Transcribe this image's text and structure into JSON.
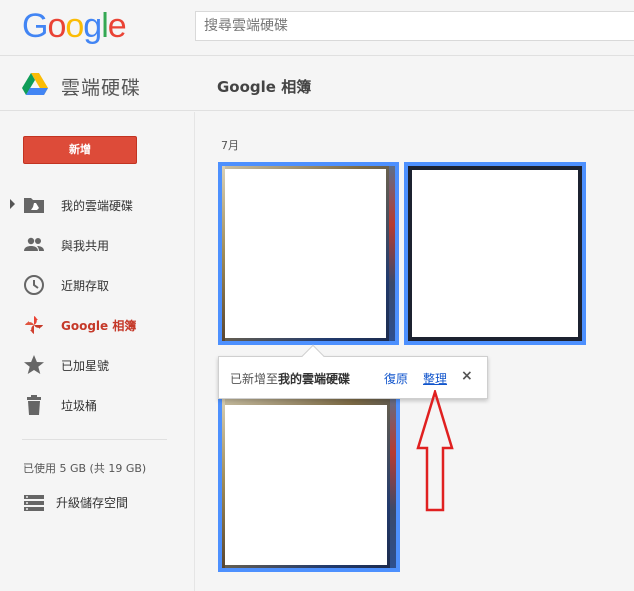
{
  "header": {
    "logo_letters": [
      {
        "ch": "G",
        "color": "#4285f4"
      },
      {
        "ch": "o",
        "color": "#ea4335"
      },
      {
        "ch": "o",
        "color": "#fbbc05"
      },
      {
        "ch": "g",
        "color": "#4285f4"
      },
      {
        "ch": "l",
        "color": "#34a853"
      },
      {
        "ch": "e",
        "color": "#ea4335"
      }
    ],
    "search_placeholder": "搜尋雲端硬碟"
  },
  "subheader": {
    "app_title": "雲端硬碟",
    "section_title": "Google 相簿"
  },
  "sidebar": {
    "new_button": "新增",
    "items": [
      {
        "label": "我的雲端硬碟",
        "icon": "drive-folder-icon"
      },
      {
        "label": "與我共用",
        "icon": "people-icon"
      },
      {
        "label": "近期存取",
        "icon": "clock-icon"
      },
      {
        "label": "Google 相簿",
        "icon": "pinwheel-icon"
      },
      {
        "label": "已加星號",
        "icon": "star-icon"
      },
      {
        "label": "垃圾桶",
        "icon": "trash-icon"
      }
    ],
    "storage_text": "已使用 5 GB (共 19 GB)",
    "upgrade_label": "升級儲存空間"
  },
  "content": {
    "month_label": "7月"
  },
  "toast": {
    "message_prefix": "已新增至",
    "message_target": "我的雲端硬碟",
    "undo_label": "復原",
    "organize_label": "整理",
    "close_glyph": "×"
  },
  "colors": {
    "new_button": "#dd4b39",
    "selection_border": "#4d90fe",
    "active_nav": "#c53929",
    "link": "#1155cc",
    "annotation_arrow": "#e02020"
  }
}
